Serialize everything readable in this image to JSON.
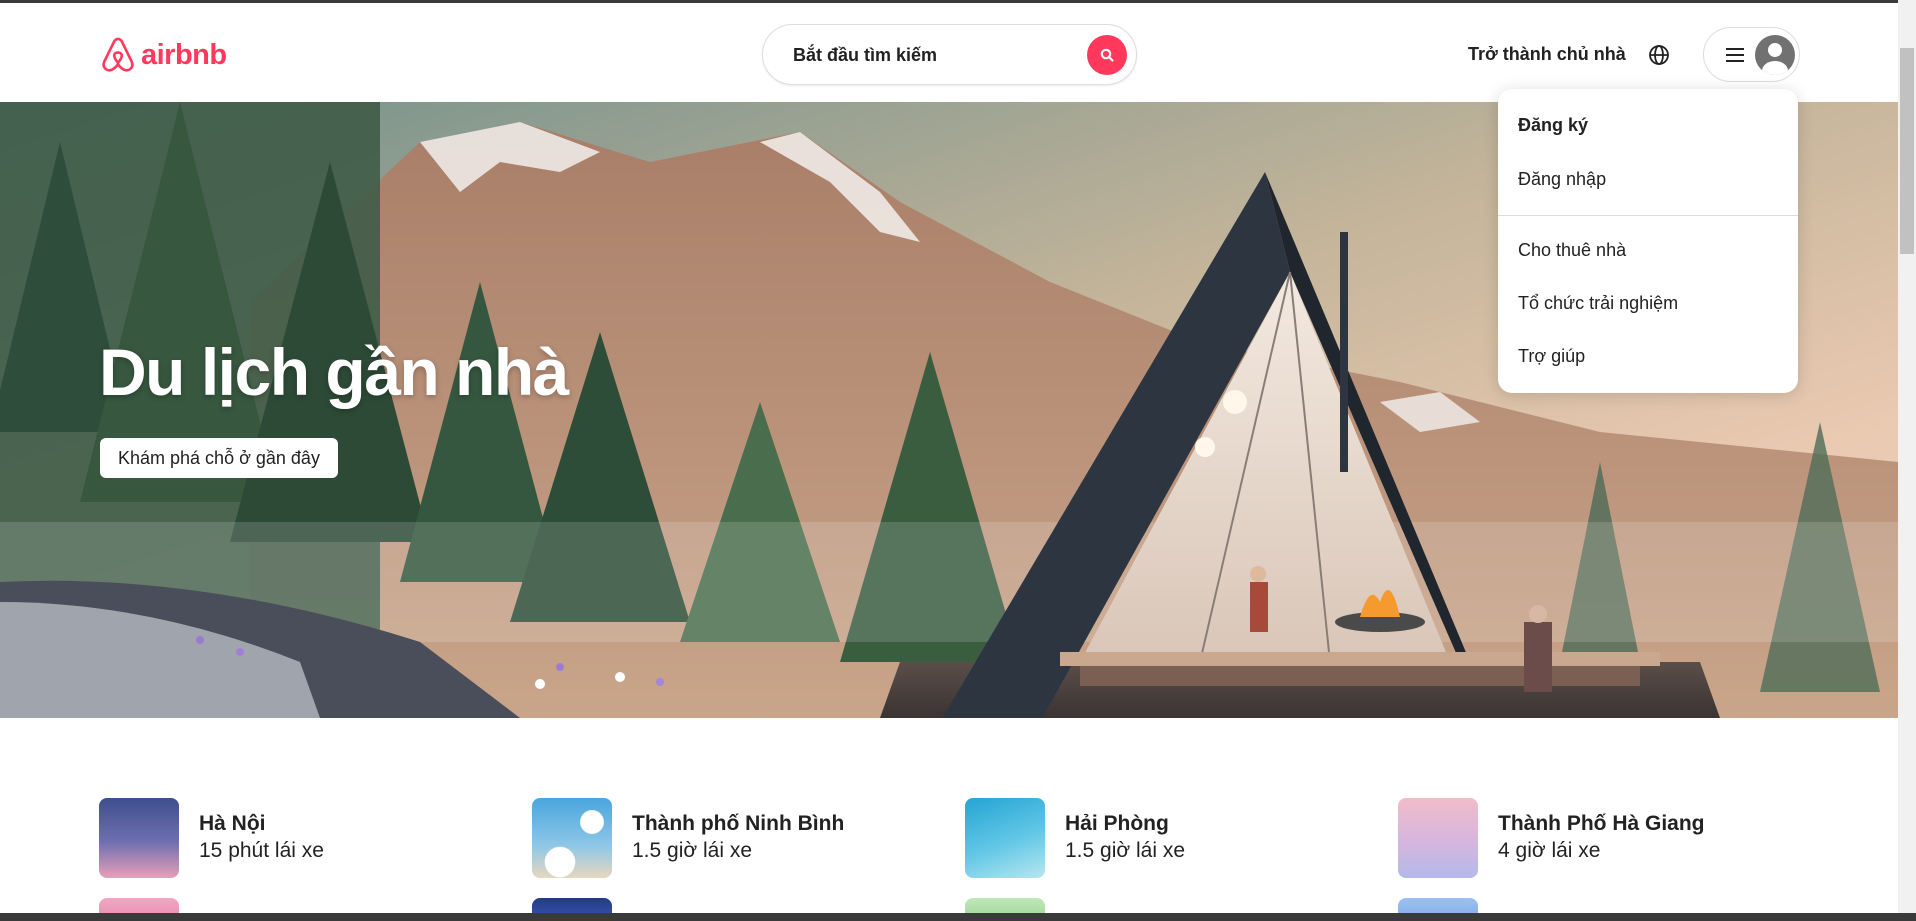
{
  "header": {
    "logo_text": "airbnb",
    "search_placeholder": "Bắt đầu tìm kiếm",
    "host_link": "Trở thành chủ nhà",
    "brand_color": "#ff385c"
  },
  "hero": {
    "title": "Du lịch gần nhà",
    "button": "Khám phá chỗ ở gần đây"
  },
  "dropdown": {
    "signup": "Đăng ký",
    "login": "Đăng nhập",
    "host_home": "Cho thuê nhà",
    "host_experience": "Tổ chức trải nghiệm",
    "help": "Trợ giúp"
  },
  "nearby": [
    {
      "name": "Hà Nội",
      "distance": "15 phút lái xe"
    },
    {
      "name": "Thành phố Ninh Bình",
      "distance": "1.5 giờ lái xe"
    },
    {
      "name": "Hải Phòng",
      "distance": "1.5 giờ lái xe"
    },
    {
      "name": "Thành Phố Hà Giang",
      "distance": "4 giờ lái xe"
    }
  ]
}
